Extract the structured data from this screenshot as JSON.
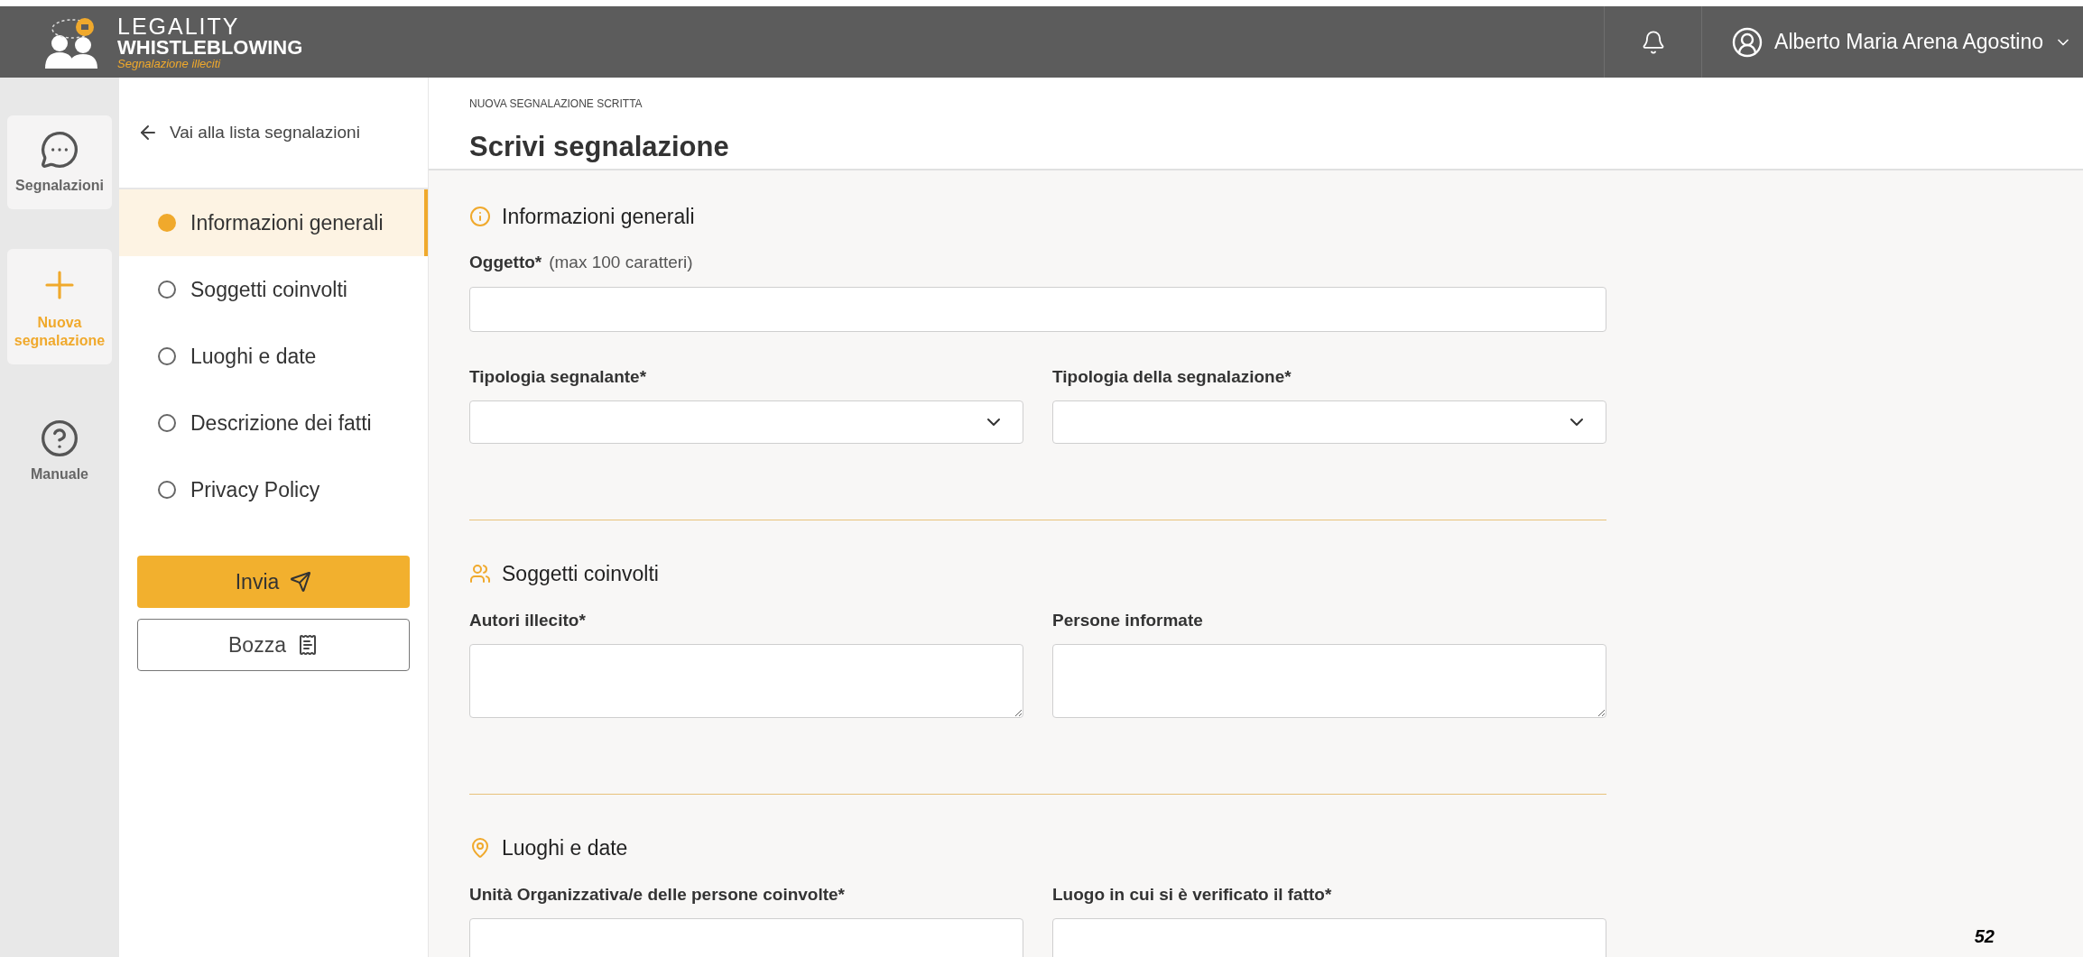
{
  "header": {
    "logo": {
      "line1": "LEGALITY",
      "line2": "WHISTLEBLOWING",
      "line3": "Segnalazione illeciti"
    },
    "user": "Alberto Maria Arena Agostino"
  },
  "rail": [
    {
      "kind": "chat",
      "label": "Segnalazioni",
      "selected": false
    },
    {
      "kind": "plus",
      "label": "Nuova segnalazione",
      "selected": true
    },
    {
      "kind": "help",
      "label": "Manuale",
      "selected": false
    }
  ],
  "steps_panel": {
    "back_link": "Vai alla lista segnalazioni",
    "steps": [
      {
        "label": "Informazioni generali",
        "selected": true
      },
      {
        "label": "Soggetti coinvolti",
        "selected": false
      },
      {
        "label": "Luoghi e date",
        "selected": false
      },
      {
        "label": "Descrizione dei fatti",
        "selected": false
      },
      {
        "label": "Privacy Policy",
        "selected": false
      }
    ],
    "buttons": [
      {
        "kind": "primary",
        "label": "Invia"
      },
      {
        "kind": "secondary",
        "label": "Bozza"
      }
    ]
  },
  "page": {
    "breadcrumb": "NUOVA SEGNALAZIONE SCRITTA",
    "title": "Scrivi segnalazione"
  },
  "sections": [
    {
      "kind": "info",
      "title": "Informazioni generali",
      "rows": [
        [
          {
            "kind": "input",
            "label": "Oggetto*",
            "hint": "(max 100 caratteri)"
          }
        ],
        [
          {
            "kind": "select",
            "label": "Tipologia segnalante*"
          },
          {
            "kind": "select",
            "label": "Tipologia della segnalazione*"
          }
        ]
      ]
    },
    {
      "kind": "people",
      "title": "Soggetti coinvolti",
      "rows": [
        [
          {
            "kind": "textarea",
            "label": "Autori illecito*"
          },
          {
            "kind": "textarea",
            "label": "Persone informate"
          }
        ]
      ]
    },
    {
      "kind": "pin",
      "title": "Luoghi e date",
      "rows": [
        [
          {
            "kind": "input",
            "label": "Unità Organizzativa/e delle persone coinvolte*"
          },
          {
            "kind": "input",
            "label": "Luogo in cui si è verificato il fatto*"
          }
        ]
      ]
    }
  ],
  "page_number": "52"
}
